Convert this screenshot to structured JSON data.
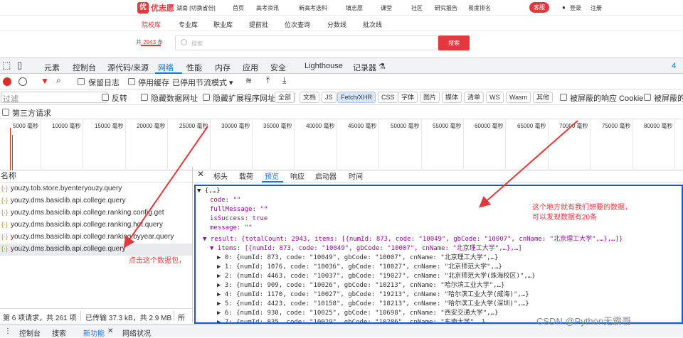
{
  "site": {
    "logo": "优志愿",
    "location": "湖南 [切换省份]",
    "nav": [
      "首页",
      "高考资讯",
      "新高考选科",
      "填志愿",
      "课堂",
      "社区",
      "研究报告",
      "易度排名"
    ],
    "kefu": "客服",
    "login": "登录",
    "register": "注册",
    "subnav": [
      "院校库",
      "专业库",
      "职业库",
      "提前批",
      "位次查询",
      "分数线",
      "批次线"
    ],
    "count_prefix": "共",
    "count": "2943",
    "count_suffix": "条",
    "search_placeholder": "搜索",
    "search_button": "搜索"
  },
  "devtools": {
    "tabs": [
      "元素",
      "控制台",
      "源代码/来源",
      "网络",
      "性能",
      "内存",
      "应用",
      "安全",
      "Lighthouse",
      "记录器"
    ],
    "toolbar1": {
      "preserve_log": "保留日志",
      "disable_cache": "停用缓存",
      "throttle": "已停用节流模式"
    },
    "toolbar2": {
      "filter_placeholder": "过滤",
      "invert": "反转",
      "hide_data_urls": "隐藏数据网址",
      "hide_ext": "隐藏扩展程序网址",
      "chips": [
        "全部",
        "文档",
        "JS",
        "Fetch/XHR",
        "CSS",
        "字体",
        "图片",
        "媒体",
        "清单",
        "WS",
        "Wasm",
        "其他"
      ],
      "blocked_cookie": "被屏蔽的响应 Cookie",
      "blocked_req": "被屏蔽的"
    },
    "third_party": "第三方请求",
    "timeline_ticks": [
      "5000 毫秒",
      "10000 毫秒",
      "15000 毫秒",
      "20000 毫秒",
      "25000 毫秒",
      "30000 毫秒",
      "35000 毫秒",
      "40000 毫秒",
      "45000 毫秒",
      "50000 毫秒",
      "55000 毫秒",
      "60000 毫秒",
      "65000 毫秒",
      "70000 毫秒",
      "75000 毫秒",
      "80000 毫秒"
    ],
    "name_header": "名称",
    "requests": [
      "youzy.tob.store.byenteryouzy.query",
      "youzy.dms.basiclib.api.college.query",
      "youzy.dms.basiclib.api.college.ranking.config.get",
      "youzy.dms.basiclib.api.college.ranking.hot.query",
      "youzy.dms.basiclib.api.college.ranking.byyear.query",
      "youzy.dms.basiclib.api.college.query"
    ],
    "status": {
      "requests": "第 6 项请求，共 261 项",
      "transferred": "已传输 37.3 kB，共 2.9 MB",
      "more": "所"
    },
    "detail_tabs": [
      "标头",
      "载荷",
      "预览",
      "响应",
      "启动器",
      "时间"
    ],
    "preview_lines": [
      {
        "t": "▼ {,…}"
      },
      {
        "t": "code: \"\""
      },
      {
        "t": "fullMessage: \"\""
      },
      {
        "t": "isSuccess: true"
      },
      {
        "t": "message: \"\""
      },
      {
        "t": "▼ result: {totalCount: 2943, items: [{numId: 873, code: \"10049\", gbCode: \"10007\", cnName: \"北京理工大学\",…},…]}"
      },
      {
        "t": "▼ items: [{numId: 873, code: \"10049\", gbCode: \"10007\", cnName: \"北京理工大学\",…},…]"
      },
      {
        "t": "▶ 0: {numId: 873, code: \"10049\", gbCode: \"10007\", cnName: \"北京理工大学\",…}"
      },
      {
        "t": "▶ 1: {numId: 1076, code: \"10036\", gbCode: \"10027\", cnName: \"北京师范大学\",…}"
      },
      {
        "t": "▶ 2: {numId: 4463, code: \"10037\", gbCode: \"19027\", cnName: \"北京师范大学(珠海校区)\",…}"
      },
      {
        "t": "▶ 3: {numId: 909, code: \"10026\", gbCode: \"10213\", cnName: \"哈尔滨工业大学\",…}"
      },
      {
        "t": "▶ 4: {numId: 1170, code: \"10027\", gbCode: \"19213\", cnName: \"哈尔滨工业大学(威海)\",…}"
      },
      {
        "t": "▶ 5: {numId: 4423, code: \"10158\", gbCode: \"18213\", cnName: \"哈尔滨工业大学(深圳)\",…}"
      },
      {
        "t": "▶ 6: {numId: 930, code: \"10025\", gbCode: \"10698\", cnName: \"西安交通大学\",…}"
      },
      {
        "t": "▶ 7: {numId: 835, code: \"10029\", gbCode: \"10286\", cnName: \"东南大学\",…}"
      }
    ],
    "drawer_tabs": [
      "控制台",
      "搜索",
      "新功能",
      "网络状况"
    ]
  },
  "annotations": {
    "click_hint": "点击这个数据包，",
    "data_hint_1": "这个地方就有我们想要的数据，",
    "data_hint_2": "可以发现数据有20条"
  },
  "watermark": "CSDN @Python无霸哥",
  "colors": {
    "accent": "#e4393c",
    "devtools_blue": "#1a73e8",
    "highlight": "#1a57d6"
  }
}
